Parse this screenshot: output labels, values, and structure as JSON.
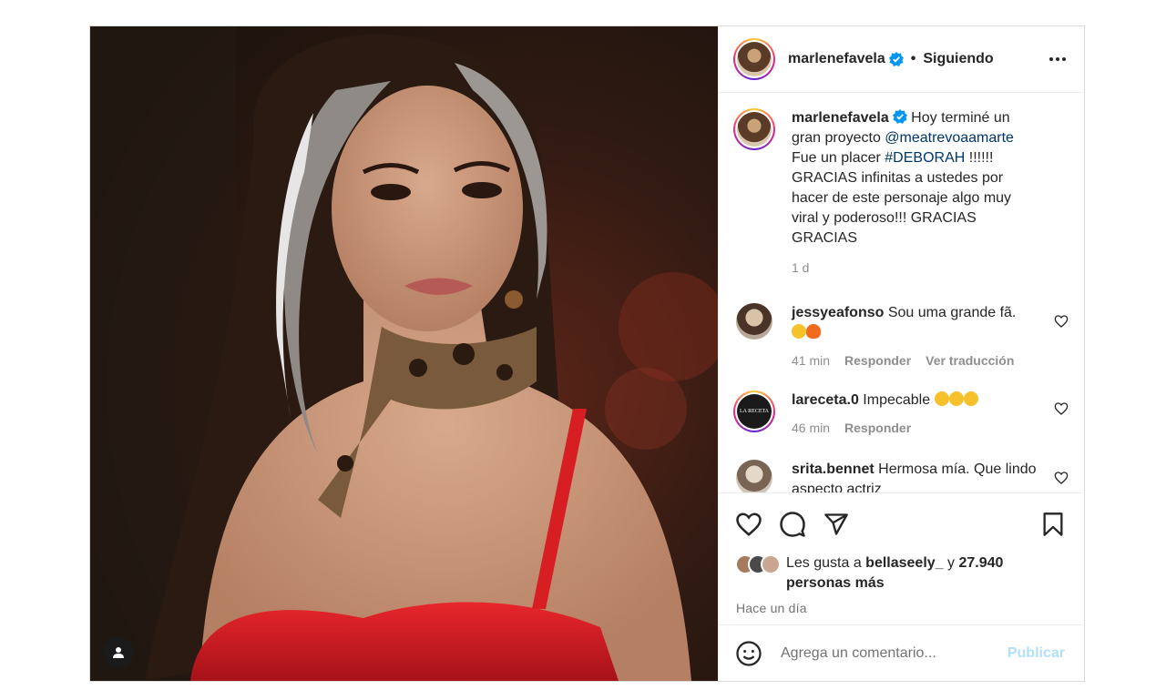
{
  "post": {
    "username": "marlenefavela",
    "separator": "•",
    "follow_status": "Siguiendo",
    "caption": {
      "username": "marlenefavela",
      "text_1": " Hoy terminé un gran proyecto ",
      "mention": "@meatrevoaamarte",
      "text_2": " Fue un placer ",
      "hashtag": "#DEBORAH",
      "text_3": " !!!!!! GRACIAS infinitas a ustedes por hacer de este personaje algo muy viral y poderoso!!! GRACIAS GRACIAS",
      "time": "1 d"
    },
    "comments": [
      {
        "username": "jessyeafonso",
        "text": " Sou uma grande fã.",
        "time": "41 min",
        "reply": "Responder",
        "translate": "Ver traducción"
      },
      {
        "username": "lareceta.0",
        "text": " Impecable ",
        "time": "46 min",
        "reply": "Responder"
      },
      {
        "username": "srita.bennet",
        "text": " Hermosa mía. Que lindo aspecto actriz"
      }
    ],
    "likes": {
      "prefix": "Les gusta a ",
      "user": "bellaseely_",
      "middle": " y ",
      "count": "27.940 personas más"
    },
    "timestamp": "Hace un día",
    "comment_box": {
      "placeholder": "Agrega un comentario...",
      "publish": "Publicar"
    },
    "avatar2_text": "LA RECETA",
    "colors": {
      "link": "#00376b",
      "verified": "#0095f6",
      "publish_disabled": "#b2dffc",
      "muted": "#8e8e8e"
    },
    "icons": [
      "more-icon",
      "verified-icon",
      "heart-icon",
      "comment-icon",
      "share-icon",
      "bookmark-icon",
      "emoji-icon",
      "user-tag-icon"
    ]
  }
}
